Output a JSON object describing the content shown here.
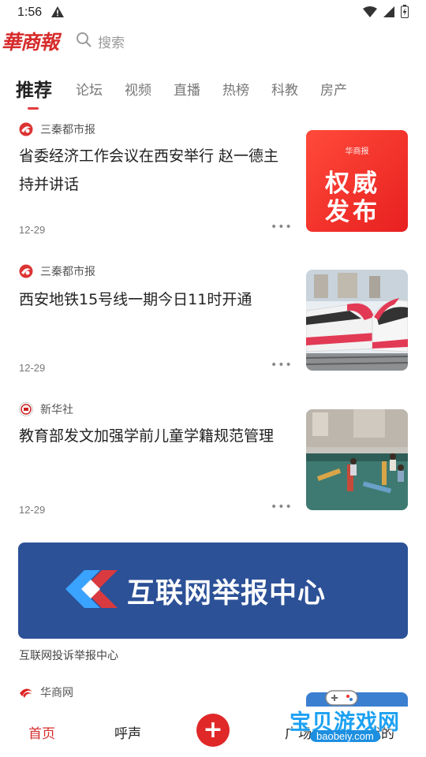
{
  "status": {
    "time": "1:56"
  },
  "app": {
    "logo_text": "華商報"
  },
  "search": {
    "placeholder": "搜索"
  },
  "tabs": [
    {
      "label": "推荐",
      "active": true
    },
    {
      "label": "论坛"
    },
    {
      "label": "视频"
    },
    {
      "label": "直播"
    },
    {
      "label": "热榜"
    },
    {
      "label": "科教"
    },
    {
      "label": "房产"
    }
  ],
  "news": [
    {
      "source": "三秦都市报",
      "title": "省委经济工作会议在西安举行 赵一德主持并讲话",
      "date": "12-29",
      "thumb_text": "权威发布",
      "thumb_caption": "华商报"
    },
    {
      "source": "三秦都市报",
      "title": "西安地铁15号线一期今日11时开通",
      "date": "12-29"
    },
    {
      "source": "新华社",
      "title": "教育部发文加强学前儿童学籍规范管理",
      "date": "12-29"
    },
    {
      "source": "华商网"
    }
  ],
  "banner": {
    "text": "互联网举报中心",
    "caption": "互联网投诉举报中心"
  },
  "bottom_nav": {
    "home": "首页",
    "voice": "呼声",
    "plaza": "广场",
    "mine": "我的"
  },
  "watermark": {
    "text": "宝贝游戏网",
    "url": "baobeiy.com"
  },
  "colors": {
    "brand_red": "#d62c2c",
    "banner_blue": "#2c5197"
  }
}
